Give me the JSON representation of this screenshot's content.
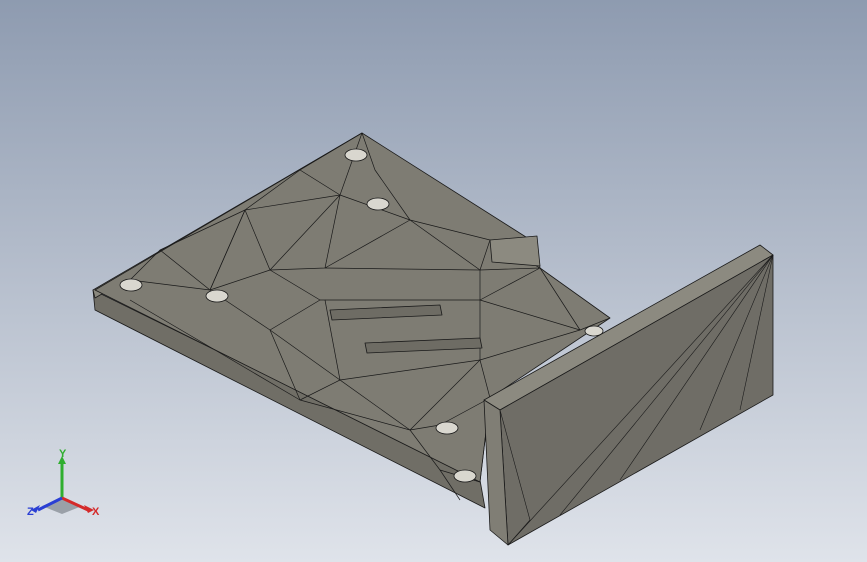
{
  "viewport": {
    "background_top": "#8e9bb0",
    "background_bottom": "#dfe3ea"
  },
  "model": {
    "body_color": "#86847a",
    "top_face_color": "#7e7c73",
    "wall_face_color": "#6f6d66",
    "edge_color": "#1a1a1a"
  },
  "triad": {
    "x_label": "X",
    "y_label": "Y",
    "z_label": "Z",
    "x_color": "#d42a2a",
    "y_color": "#2fae2f",
    "z_color": "#2a3fd4"
  }
}
